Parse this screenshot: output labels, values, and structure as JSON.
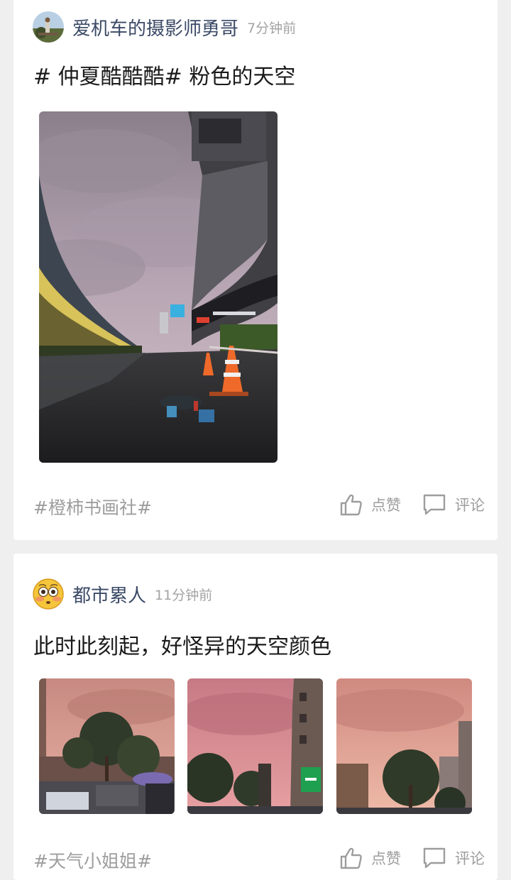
{
  "posts": [
    {
      "author": "爱机车的摄影师勇哥",
      "time": "7分钟前",
      "content": "# 仲夏酷酷酷# 粉色的天空",
      "tag": "#橙柿书画社#",
      "like_label": "点赞",
      "comment_label": "评论",
      "avatar_icon": "motorcycle-photographer-avatar"
    },
    {
      "author": "都市累人",
      "time": "11分钟前",
      "content": "此时此刻起，好怪异的天空颜色",
      "tag": "#天气小姐姐#",
      "like_label": "点赞",
      "comment_label": "评论",
      "avatar_icon": "flushed-face-emoji-avatar"
    }
  ],
  "colors": {
    "author": "#3b4a66",
    "muted": "#9d9d9d",
    "background": "#efefef"
  }
}
